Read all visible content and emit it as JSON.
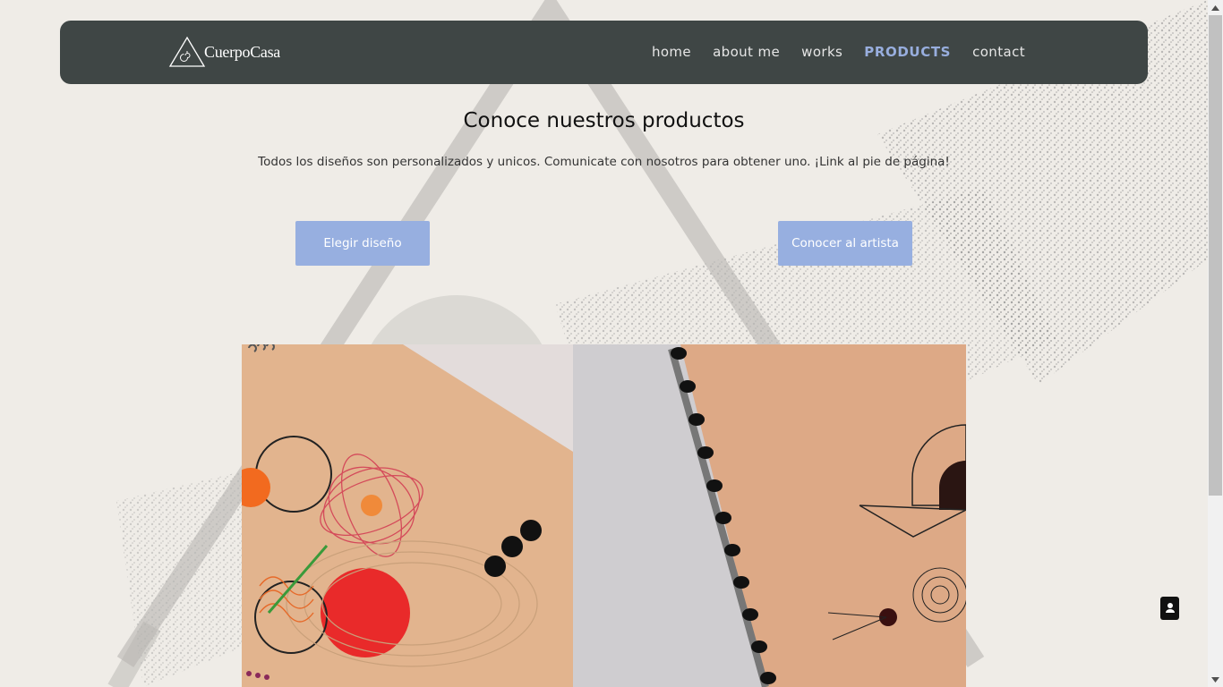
{
  "brand": {
    "name": "CuerpoCasa",
    "logo_icon": "triangle-spiral-icon"
  },
  "nav": {
    "items": [
      {
        "label": "home",
        "active": false
      },
      {
        "label": "about me",
        "active": false
      },
      {
        "label": "works",
        "active": false
      },
      {
        "label": "PRODUCTS",
        "active": true
      },
      {
        "label": "contact",
        "active": false
      }
    ]
  },
  "main": {
    "title": "Conoce nuestros productos",
    "subtitle": "Todos los diseños son personalizados y unicos. Comunicate con nosotros para obtener uno. ¡Link al pie de página!",
    "buttons": {
      "choose_design": "Elegir diseño",
      "meet_artist": "Conocer al artista"
    }
  },
  "colors": {
    "navbar_bg": "#3f4645",
    "accent": "#97afe0",
    "page_bg": "#efece7"
  },
  "contact_fab": {
    "icon": "contact-card-icon"
  }
}
